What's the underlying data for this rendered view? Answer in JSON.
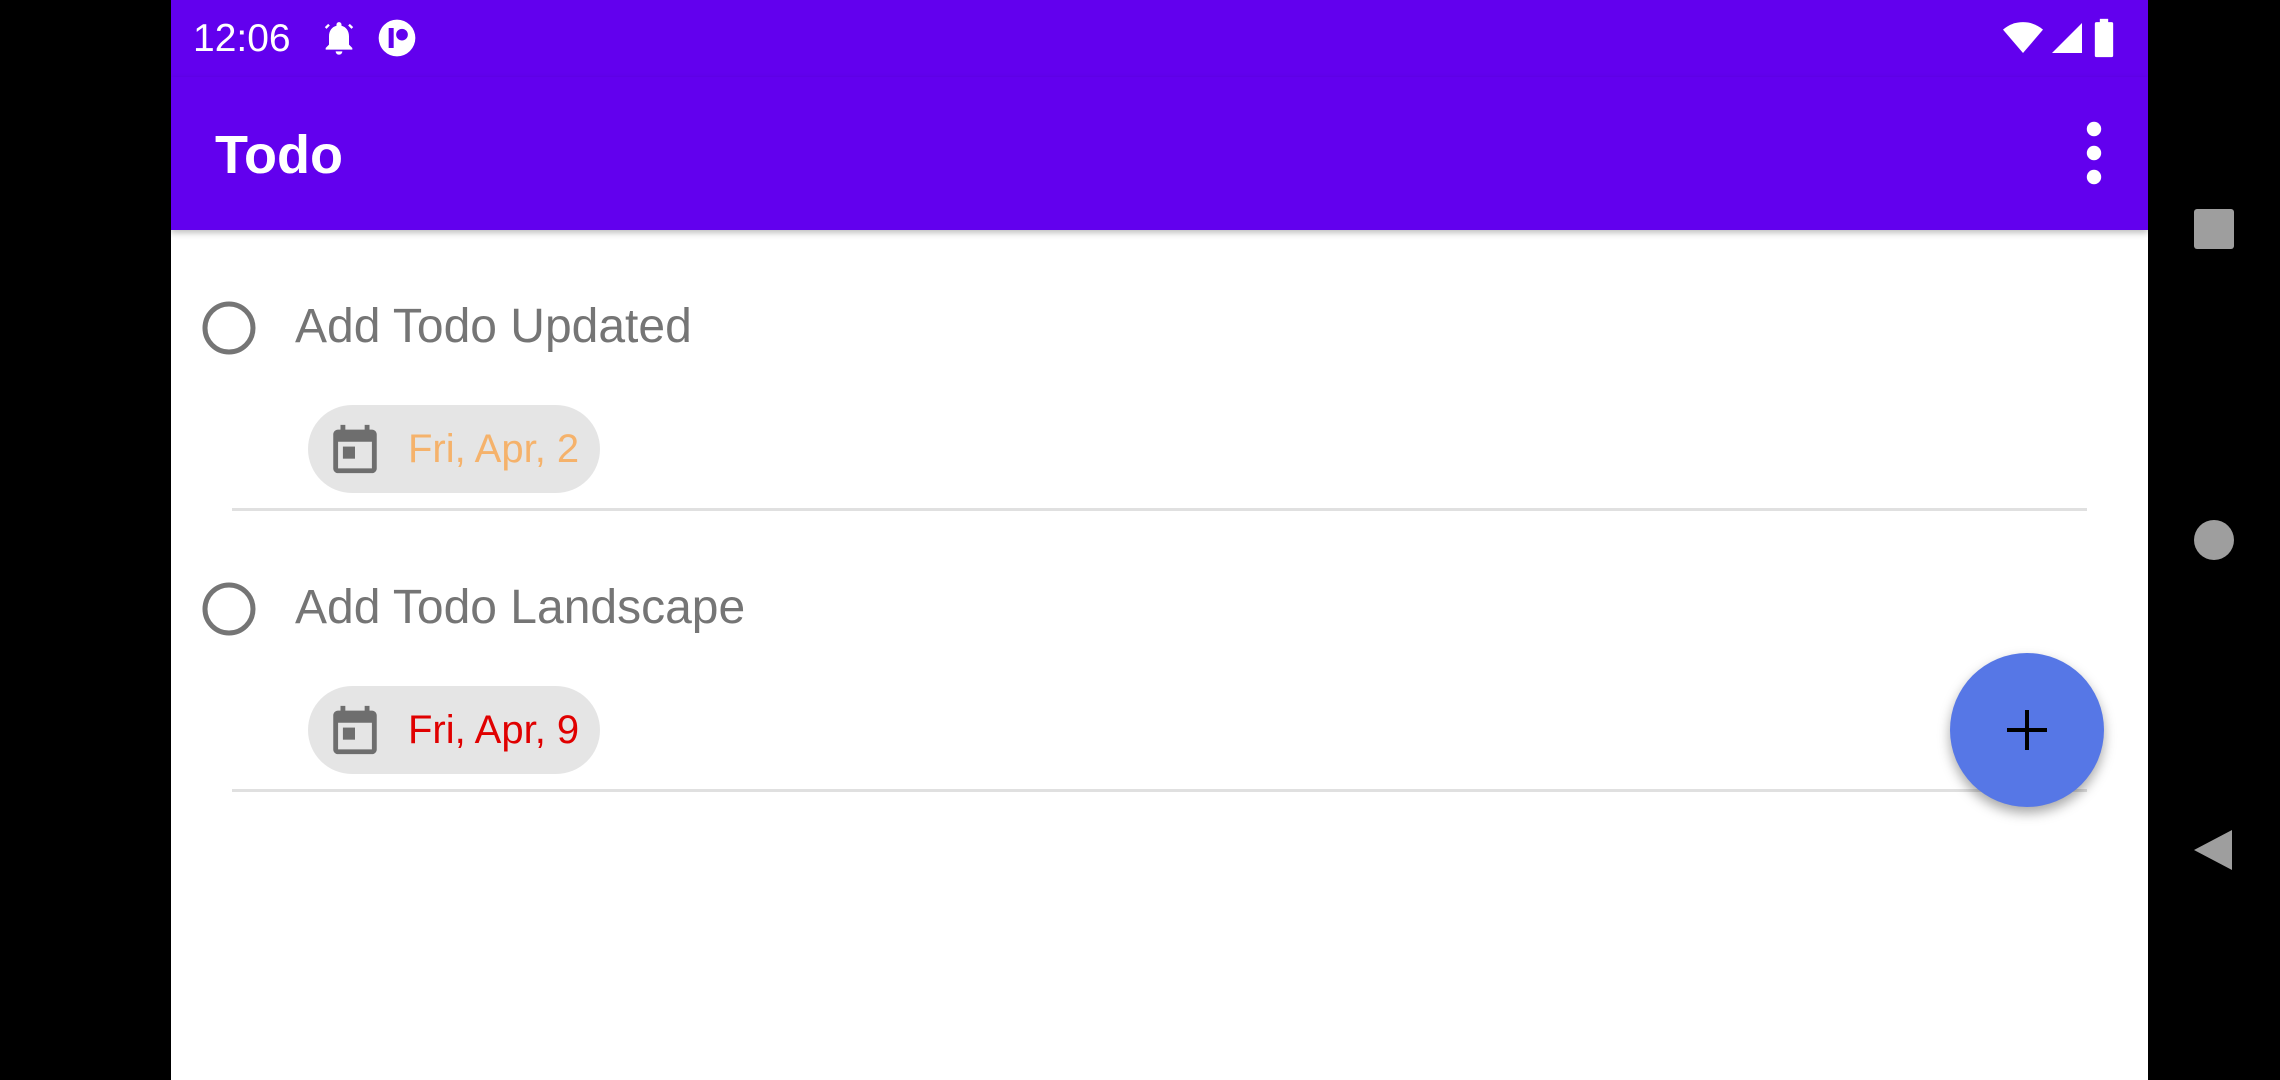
{
  "status_bar": {
    "time": "12:06",
    "icons": [
      "alarm-icon",
      "app-notification-icon",
      "wifi-icon",
      "signal-icon",
      "battery-icon"
    ]
  },
  "app_bar": {
    "title": "Todo",
    "overflow_icon": "more-vert-icon"
  },
  "todos": [
    {
      "title": "Add Todo Updated",
      "completed": false,
      "due_date": "Fri, Apr, 2",
      "due_color": "#f5b26b"
    },
    {
      "title": "Add Todo Landscape",
      "completed": false,
      "due_date": "Fri, Apr, 9",
      "due_color": "#e00000"
    }
  ],
  "fab": {
    "icon": "plus-icon"
  },
  "nav_bar": {
    "buttons": [
      "recents-icon",
      "home-icon",
      "back-icon"
    ]
  },
  "colors": {
    "primary": "#6200ee",
    "fab": "#5677e6"
  }
}
